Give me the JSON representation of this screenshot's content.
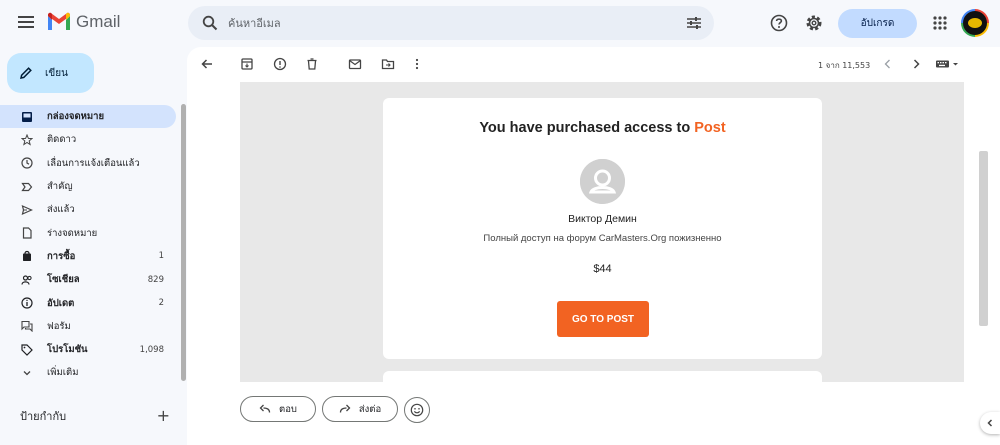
{
  "app": {
    "name": "Gmail"
  },
  "search": {
    "placeholder": "ค้นหาอีเมล"
  },
  "header": {
    "upgrade_label": "อัปเกรด"
  },
  "compose": {
    "label": "เขียน"
  },
  "sidebar": {
    "items": [
      {
        "label": "กล่องจดหมาย",
        "count": "",
        "active": true,
        "bold": true,
        "icon": "inbox-icon"
      },
      {
        "label": "ติดดาว",
        "count": "",
        "active": false,
        "bold": false,
        "icon": "star-icon"
      },
      {
        "label": "เลื่อนการแจ้งเตือนแล้ว",
        "count": "",
        "active": false,
        "bold": false,
        "icon": "clock-icon"
      },
      {
        "label": "สำคัญ",
        "count": "",
        "active": false,
        "bold": false,
        "icon": "label-important-icon"
      },
      {
        "label": "ส่งแล้ว",
        "count": "",
        "active": false,
        "bold": false,
        "icon": "send-icon"
      },
      {
        "label": "ร่างจดหมาย",
        "count": "",
        "active": false,
        "bold": false,
        "icon": "draft-icon"
      },
      {
        "label": "การซื้อ",
        "count": "1",
        "active": false,
        "bold": true,
        "icon": "shopping-bag-icon"
      },
      {
        "label": "โซเชียล",
        "count": "829",
        "active": false,
        "bold": true,
        "icon": "people-icon"
      },
      {
        "label": "อัปเดต",
        "count": "2",
        "active": false,
        "bold": true,
        "icon": "info-icon"
      },
      {
        "label": "ฟอรัม",
        "count": "",
        "active": false,
        "bold": false,
        "icon": "forum-icon"
      },
      {
        "label": "โปรโมชัน",
        "count": "1,098",
        "active": false,
        "bold": true,
        "icon": "tag-icon"
      },
      {
        "label": "เพิ่มเติม",
        "count": "",
        "active": false,
        "bold": false,
        "icon": "chevron-down-icon"
      }
    ],
    "labels_heading": "ป้ายกำกับ"
  },
  "toolbar": {
    "pager": "1 จาก 11,553"
  },
  "email": {
    "title_prefix": "You have purchased access to ",
    "title_highlight": "Post",
    "author_name": "Виктор Демин",
    "description": "Полный доступ на форум CarMasters.Org пожизненно",
    "price": "$44",
    "button_label": "GO TO POST"
  },
  "actions": {
    "reply_label": "ตอบ",
    "forward_label": "ส่งต่อ"
  },
  "colors": {
    "accent": "#f26322",
    "compose_bg": "#c2e7ff",
    "active_nav": "#d3e3fd",
    "upgrade_bg": "#c2dbff"
  }
}
